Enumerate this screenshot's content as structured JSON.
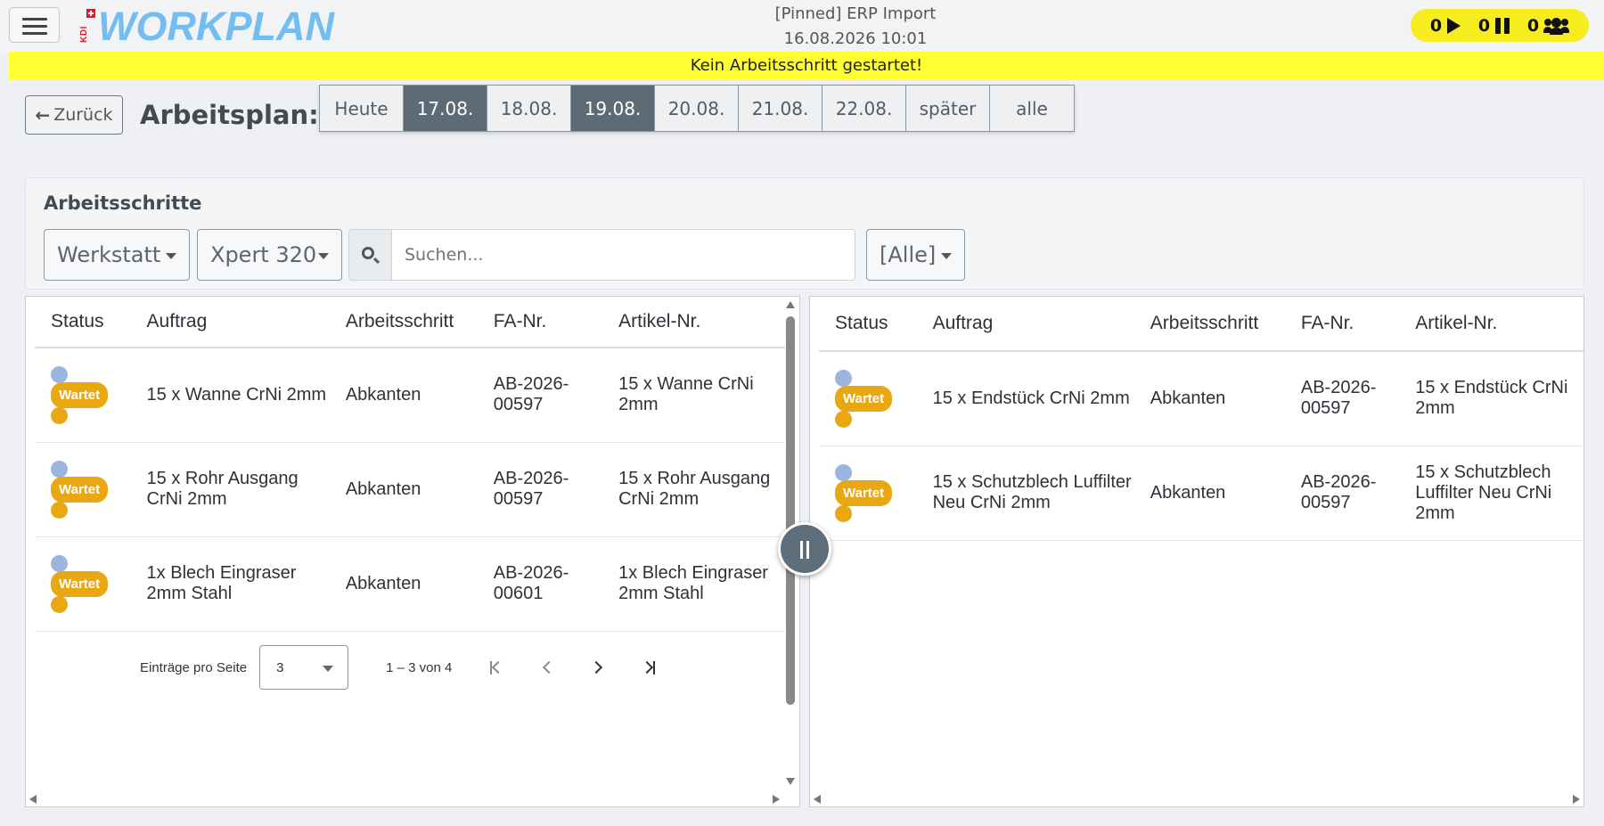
{
  "header": {
    "brand_logo_small": "KDI",
    "brand_logo": "WORKPLAN",
    "title": "[Pinned] ERP Import",
    "datetime": "16.08.2026 10:01",
    "counters": {
      "running": "0",
      "paused": "0",
      "users": "0"
    }
  },
  "banner": {
    "text": "Kein Arbeitsschritt gestartet!"
  },
  "toolbar": {
    "back_label": "Zurück",
    "page_title": "Arbeitsplan:",
    "date_tabs": [
      {
        "label": "Heute",
        "active": false
      },
      {
        "label": "17.08.",
        "active": true
      },
      {
        "label": "18.08.",
        "active": false
      },
      {
        "label": "19.08.",
        "active": true
      },
      {
        "label": "20.08.",
        "active": false
      },
      {
        "label": "21.08.",
        "active": false
      },
      {
        "label": "22.08.",
        "active": false
      },
      {
        "label": "später",
        "active": false
      },
      {
        "label": "alle",
        "active": false
      }
    ]
  },
  "filters": {
    "section_title": "Arbeitsschritte",
    "location_select": "Werkstatt",
    "machine_select": "Xpert 320",
    "search_placeholder": "Suchen...",
    "status_select": "[Alle]"
  },
  "left_table": {
    "columns": [
      "Status",
      "Auftrag",
      "Arbeitsschritt",
      "FA-Nr.",
      "Artikel-Nr."
    ],
    "rows": [
      {
        "status": "Wartet",
        "auftrag": "15 x Wanne CrNi 2mm",
        "arbeitsschritt": "Abkanten",
        "fa_nr": "AB-2026-00597",
        "artikel_nr": "15 x Wanne CrNi 2mm"
      },
      {
        "status": "Wartet",
        "auftrag": "15 x Rohr Ausgang CrNi 2mm",
        "arbeitsschritt": "Abkanten",
        "fa_nr": "AB-2026-00597",
        "artikel_nr": "15 x Rohr Ausgang CrNi 2mm"
      },
      {
        "status": "Wartet",
        "auftrag": "1x Blech Eingraser 2mm Stahl",
        "arbeitsschritt": "Abkanten",
        "fa_nr": "AB-2026-00601",
        "artikel_nr": "1x Blech Eingraser 2mm Stahl"
      }
    ],
    "paginator": {
      "label": "Einträge pro Seite",
      "page_size": "3",
      "range": "1 – 3 von 4"
    }
  },
  "right_table": {
    "columns": [
      "Status",
      "Auftrag",
      "Arbeitsschritt",
      "FA-Nr.",
      "Artikel-Nr."
    ],
    "rows": [
      {
        "status": "Wartet",
        "auftrag": "15 x Endstück CrNi 2mm",
        "arbeitsschritt": "Abkanten",
        "fa_nr": "AB-2026-00597",
        "artikel_nr": "15 x Endstück CrNi 2mm"
      },
      {
        "status": "Wartet",
        "auftrag": "15 x Schutzblech Luffilter Neu CrNi 2mm",
        "arbeitsschritt": "Abkanten",
        "fa_nr": "AB-2026-00597",
        "artikel_nr": "15 x Schutzblech Luffilter Neu CrNi 2mm"
      }
    ]
  },
  "colors": {
    "accent_yellow": "#ffff33",
    "counter_yellow": "#f7ed1e",
    "active_tab": "#5d6b77",
    "status_wartet": "#e9a812",
    "status_dot_blue": "#9cb4e0",
    "logo_blue": "#74bdf0"
  }
}
